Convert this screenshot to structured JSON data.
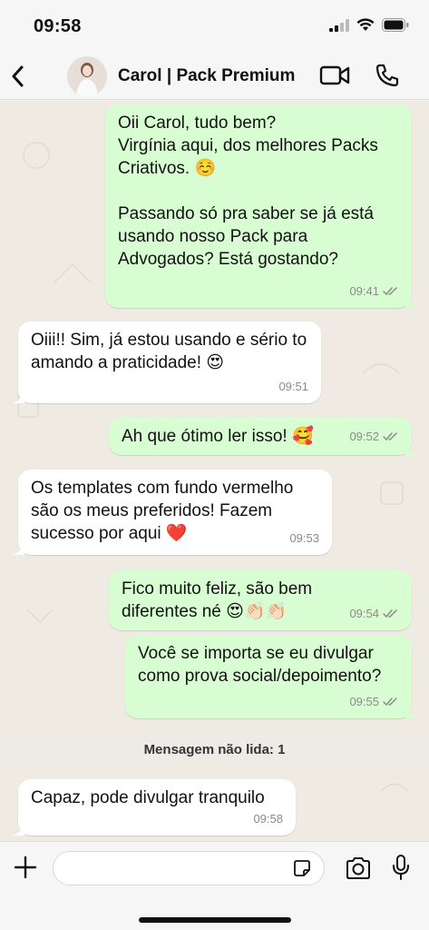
{
  "status_bar": {
    "time": "09:58"
  },
  "header": {
    "contact_name": "Carol | Pack Premium"
  },
  "messages": [
    {
      "direction": "out",
      "text": "Oii Carol, tudo bem?\nVirgínia aqui, dos melhores Packs Criativos. ☺️\n\nPassando só pra saber se já está usando nosso Pack para Advogados? Está gostando?",
      "time": "09:41",
      "read": true
    },
    {
      "direction": "in",
      "text": "Oiii!! Sim, já estou usando e sério to amando a praticidade! 😍",
      "time": "09:51"
    },
    {
      "direction": "out",
      "text": "Ah que ótimo ler isso! 🥰",
      "time": "09:52",
      "read": true
    },
    {
      "direction": "in",
      "text": "Os templates com fundo vermelho são os meus preferidos! Fazem sucesso por aqui ❤️",
      "time": "09:53"
    },
    {
      "direction": "out",
      "text": "Fico muito feliz, são bem diferentes né 😍👏🏻👏🏻",
      "time": "09:54",
      "read": true
    },
    {
      "direction": "out",
      "text": "Você se importa se eu divulgar como prova social/depoimento?",
      "time": "09:55",
      "read": true
    },
    {
      "direction": "in",
      "text": "Capaz, pode divulgar tranquilo",
      "time": "09:58"
    }
  ],
  "unread_label": "Mensagem não lida: 1",
  "composer": {
    "input_value": ""
  },
  "colors": {
    "outgoing_bubble": "#d9fdd3",
    "incoming_bubble": "#ffffff",
    "chat_background": "#efeae2",
    "read_ticks": "#8a8a8a"
  },
  "icons": [
    "back-icon",
    "video-call-icon",
    "voice-call-icon",
    "plus-icon",
    "sticker-icon",
    "camera-icon",
    "mic-icon",
    "signal-icon",
    "wifi-icon",
    "battery-icon"
  ]
}
